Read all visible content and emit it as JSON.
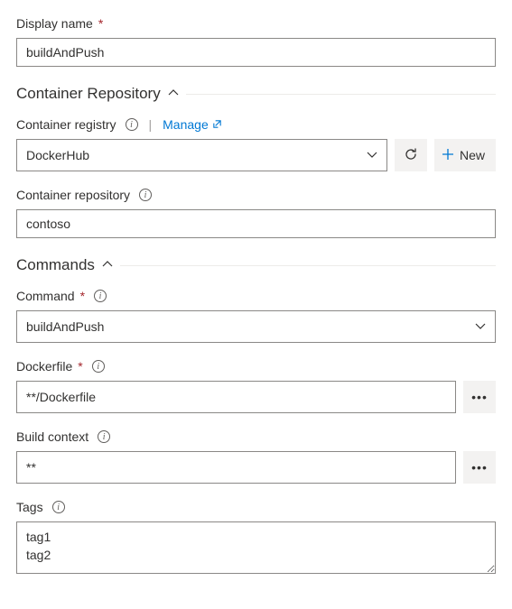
{
  "displayName": {
    "label": "Display name",
    "value": "buildAndPush"
  },
  "sections": {
    "repo": {
      "title": "Container Repository"
    },
    "commands": {
      "title": "Commands"
    }
  },
  "containerRegistry": {
    "label": "Container registry",
    "manage": "Manage",
    "value": "DockerHub",
    "newLabel": "New"
  },
  "containerRepo": {
    "label": "Container repository",
    "value": "contoso"
  },
  "command": {
    "label": "Command",
    "value": "buildAndPush"
  },
  "dockerfile": {
    "label": "Dockerfile",
    "value": "**/Dockerfile"
  },
  "buildContext": {
    "label": "Build context",
    "value": "**"
  },
  "tags": {
    "label": "Tags",
    "value": "tag1\ntag2"
  }
}
